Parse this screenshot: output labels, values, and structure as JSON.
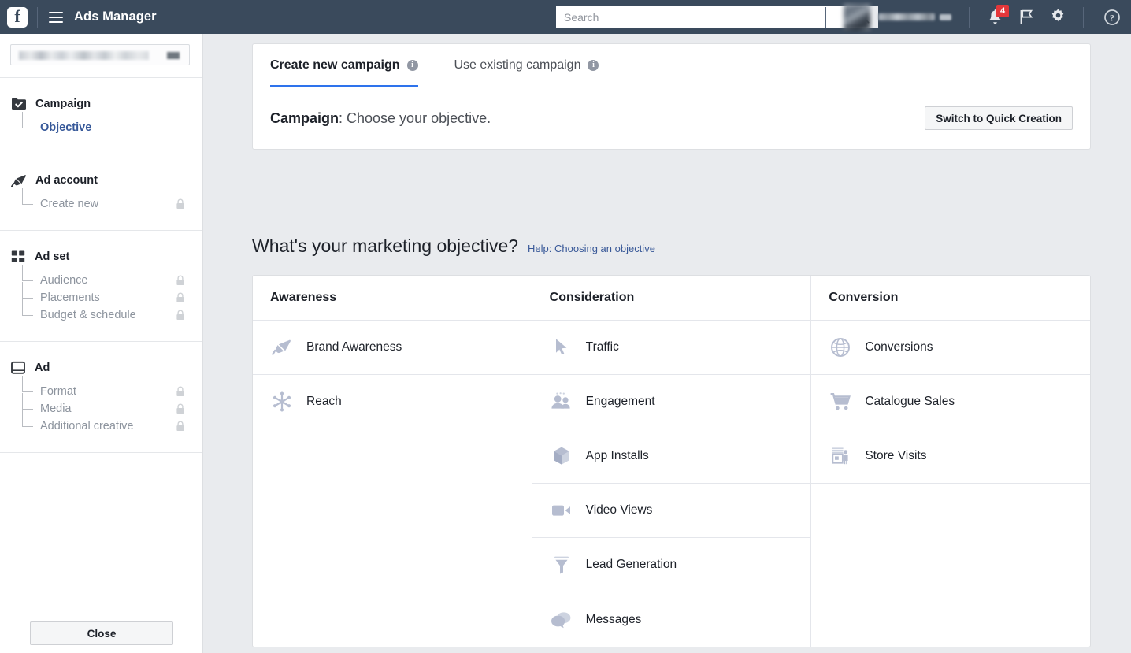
{
  "topnav": {
    "logo": "facebook-f-logo",
    "menu_icon": "hamburger-menu-icon",
    "app_title": "Ads Manager",
    "search": {
      "placeholder": "Search",
      "value": "",
      "button_icon": "search-icon"
    },
    "account_name_redacted": true,
    "notifications": {
      "icon": "bell-icon",
      "count": "4"
    },
    "flag_icon": "flag-icon",
    "settings_icon": "gear-icon",
    "help_icon": "question-mark-icon"
  },
  "sidebar": {
    "account_selector": {
      "name": "ad-account-selector",
      "value_redacted": true
    },
    "sections": [
      {
        "key": "campaign",
        "label": "Campaign",
        "icon": "checked-checkbox-icon",
        "items": [
          {
            "label": "Objective",
            "active": true,
            "locked": false
          }
        ]
      },
      {
        "key": "ad_account",
        "label": "Ad account",
        "icon": "megaphone-icon",
        "items": [
          {
            "label": "Create new",
            "active": false,
            "locked": true
          }
        ]
      },
      {
        "key": "ad_set",
        "label": "Ad set",
        "icon": "grid-squares-icon",
        "items": [
          {
            "label": "Audience",
            "active": false,
            "locked": true
          },
          {
            "label": "Placements",
            "active": false,
            "locked": true
          },
          {
            "label": "Budget & schedule",
            "active": false,
            "locked": true
          }
        ]
      },
      {
        "key": "ad",
        "label": "Ad",
        "icon": "window-frame-icon",
        "items": [
          {
            "label": "Format",
            "active": false,
            "locked": true
          },
          {
            "label": "Media",
            "active": false,
            "locked": true
          },
          {
            "label": "Additional creative",
            "active": false,
            "locked": true
          }
        ]
      }
    ],
    "close_label": "Close"
  },
  "main": {
    "tabs": [
      {
        "label": "Create new campaign",
        "active": true,
        "info": "i"
      },
      {
        "label": "Use existing campaign",
        "active": false,
        "info": "i"
      }
    ],
    "campaign_row": {
      "prefix": "Campaign",
      "text": ": Choose your objective.",
      "quick_creation_label": "Switch to Quick Creation"
    },
    "objective_heading": "What's your marketing objective?",
    "objective_help": "Help: Choosing an objective",
    "columns": [
      {
        "header": "Awareness",
        "rows": [
          {
            "label": "Brand Awareness",
            "icon": "megaphone-icon"
          },
          {
            "label": "Reach",
            "icon": "burst-radiate-icon"
          }
        ]
      },
      {
        "header": "Consideration",
        "rows": [
          {
            "label": "Traffic",
            "icon": "cursor-arrow-icon"
          },
          {
            "label": "Engagement",
            "icon": "people-group-icon"
          },
          {
            "label": "App Installs",
            "icon": "cube-box-icon"
          },
          {
            "label": "Video Views",
            "icon": "video-camera-icon"
          },
          {
            "label": "Lead Generation",
            "icon": "funnel-icon"
          },
          {
            "label": "Messages",
            "icon": "speech-bubbles-icon"
          }
        ]
      },
      {
        "header": "Conversion",
        "rows": [
          {
            "label": "Conversions",
            "icon": "globe-icon"
          },
          {
            "label": "Catalogue Sales",
            "icon": "shopping-cart-icon"
          },
          {
            "label": "Store Visits",
            "icon": "storefront-icon"
          }
        ]
      }
    ]
  },
  "colors": {
    "navbar": "#3a4a5c",
    "accent_blue": "#2e73ec",
    "link_blue": "#385898",
    "badge_red": "#e4373a",
    "page_bg": "#e9ebee",
    "objective_icon": "#b6bdd0"
  }
}
